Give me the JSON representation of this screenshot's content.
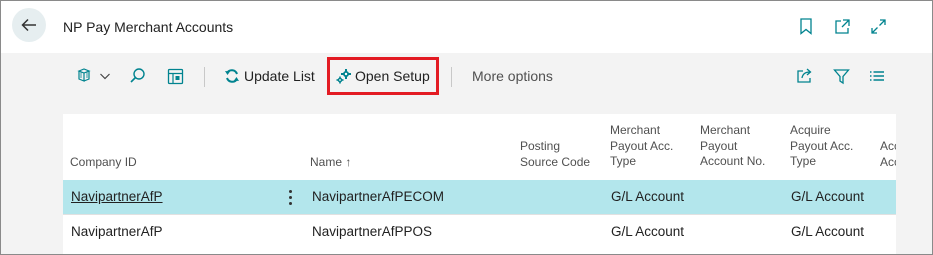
{
  "header": {
    "title": "NP Pay Merchant Accounts"
  },
  "toolbar": {
    "update_list": "Update List",
    "open_setup": "Open Setup",
    "more_options": "More options"
  },
  "grid": {
    "columns": [
      {
        "key": "company",
        "lines": [
          "Company ID"
        ]
      },
      {
        "key": "name",
        "lines": [
          "Name ↑"
        ]
      },
      {
        "key": "posting",
        "lines": [
          "Posting",
          "Source Code"
        ]
      },
      {
        "key": "mpat",
        "lines": [
          "Merchant",
          "Payout Acc.",
          "Type"
        ]
      },
      {
        "key": "mpan",
        "lines": [
          "Merchant",
          "Payout",
          "Account No."
        ]
      },
      {
        "key": "apat",
        "lines": [
          "Acquire",
          "Payout Acc.",
          "Type"
        ]
      },
      {
        "key": "extra",
        "lines": [
          "Acc",
          "Acc"
        ]
      }
    ],
    "rows": [
      {
        "company": "NavipartnerAfP",
        "name": "NavipartnerAfPECOM",
        "posting": "",
        "mpat": "G/L Account",
        "mpan": "",
        "apat": "G/L Account"
      },
      {
        "company": "NavipartnerAfP",
        "name": "NavipartnerAfPPOS",
        "posting": "",
        "mpat": "G/L Account",
        "mpan": "",
        "apat": "G/L Account"
      }
    ]
  },
  "colors": {
    "selected_row": "#b3e6ec",
    "highlight_border": "#e31b23",
    "accent": "#00838f"
  }
}
